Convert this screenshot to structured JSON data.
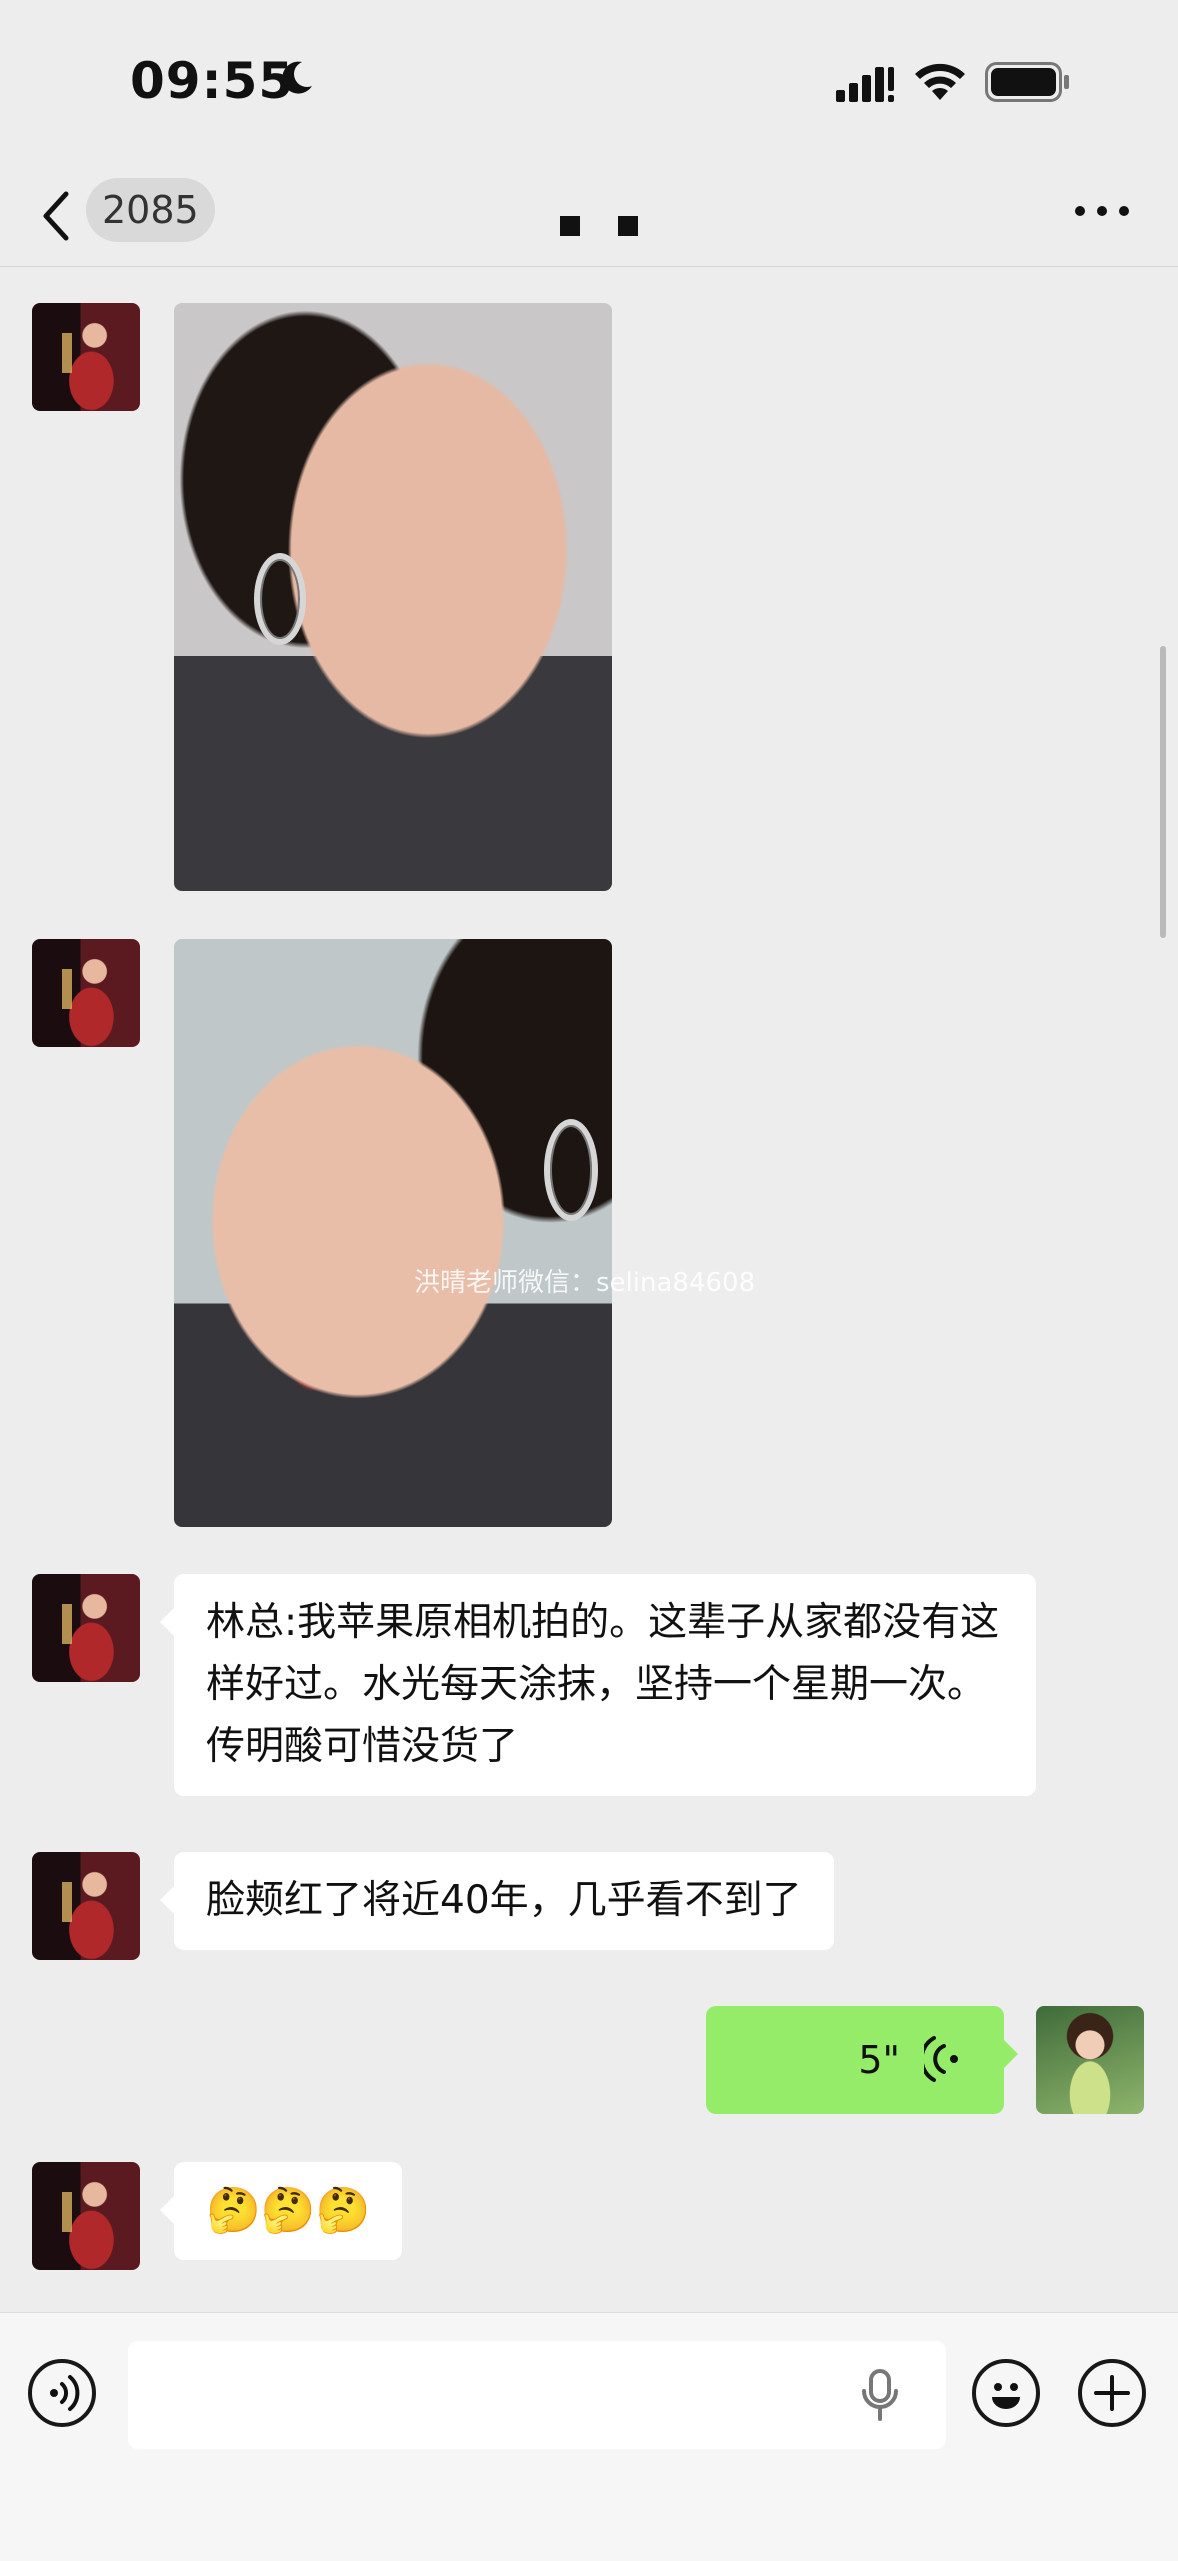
{
  "status_bar": {
    "time": "09:55"
  },
  "header": {
    "unread_count": "2085"
  },
  "messages": {
    "text1": "林总:我苹果原相机拍的。这辈子从家都没有这样好过。水光每天涂抹，坚持一个星期一次。传明酸可惜没货了",
    "text2": "脸颊红了将近40年，几乎看不到了",
    "voice_duration": "5\"",
    "emoji": "🤔🤔🤔"
  },
  "watermark": "洪晴老师微信：selina84608",
  "colors": {
    "background": "#ededed",
    "sent_bubble": "#95ec69",
    "received_bubble": "#ffffff"
  }
}
